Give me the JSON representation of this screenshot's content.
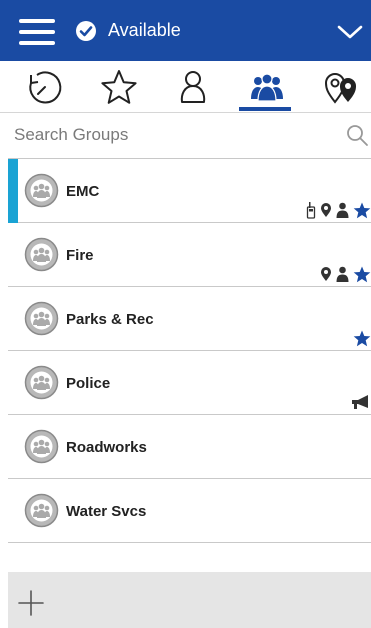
{
  "header": {
    "menu_icon": "hamburger-menu-icon",
    "status_icon": "check-circle-icon",
    "status_label": "Available",
    "dropdown_icon": "chevron-down-icon",
    "background_color": "#1a4ba3"
  },
  "tabs": [
    {
      "icon": "history-icon",
      "selected": false
    },
    {
      "icon": "star-icon",
      "selected": false
    },
    {
      "icon": "person-icon",
      "selected": false
    },
    {
      "icon": "groups-icon",
      "selected": true
    },
    {
      "icon": "map-pins-icon",
      "selected": false
    }
  ],
  "search": {
    "placeholder": "Search Groups",
    "icon": "search-icon"
  },
  "groups": [
    {
      "name": "EMC",
      "selected": true,
      "indicators": [
        "radio-icon",
        "location-pin-icon",
        "person-icon",
        "star-icon"
      ]
    },
    {
      "name": "Fire",
      "selected": false,
      "indicators": [
        "location-pin-icon",
        "person-icon",
        "star-icon"
      ]
    },
    {
      "name": "Parks & Rec",
      "selected": false,
      "indicators": [
        "star-icon"
      ]
    },
    {
      "name": "Police",
      "selected": false,
      "indicators": [
        "megaphone-icon"
      ]
    },
    {
      "name": "Roadworks",
      "selected": false,
      "indicators": []
    },
    {
      "name": "Water Svcs",
      "selected": false,
      "indicators": []
    }
  ],
  "footer": {
    "add_icon": "plus-icon"
  },
  "colors": {
    "brand_blue": "#1a4ba3",
    "selection_accent": "#1aa3d4",
    "star_color": "#1a4ba3"
  }
}
